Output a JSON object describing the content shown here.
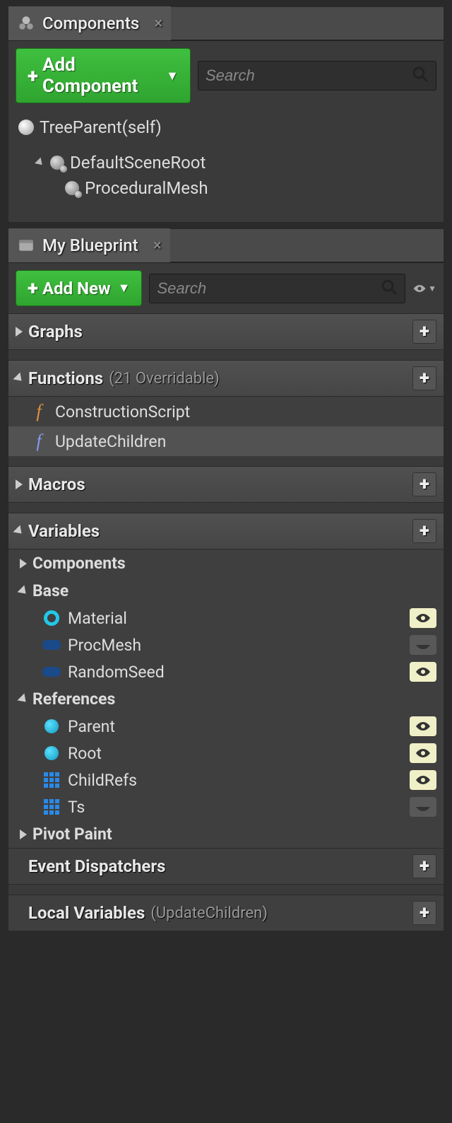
{
  "components": {
    "tab_title": "Components",
    "add_button": "Add Component",
    "search_placeholder": "Search",
    "tree": {
      "root": "TreeParent(self)",
      "scene_root": "DefaultSceneRoot",
      "child1": "ProceduralMesh"
    }
  },
  "blueprint": {
    "tab_title": "My Blueprint",
    "add_button": "Add New",
    "search_placeholder": "Search",
    "sections": {
      "graphs": {
        "label": "Graphs"
      },
      "functions": {
        "label": "Functions",
        "sub": "(21 Overridable)",
        "items": {
          "f0": "ConstructionScript",
          "f1": "UpdateChildren"
        }
      },
      "macros": {
        "label": "Macros"
      },
      "variables": {
        "label": "Variables",
        "cats": {
          "components": "Components",
          "base": {
            "label": "Base",
            "vars": {
              "v0": "Material",
              "v1": "ProcMesh",
              "v2": "RandomSeed"
            }
          },
          "references": {
            "label": "References",
            "vars": {
              "v0": "Parent",
              "v1": "Root",
              "v2": "ChildRefs",
              "v3": "Ts"
            }
          },
          "pivot": "Pivot Paint"
        }
      },
      "dispatchers": {
        "label": "Event Dispatchers"
      },
      "locals": {
        "label": "Local Variables",
        "sub": "(UpdateChildren)"
      }
    }
  }
}
